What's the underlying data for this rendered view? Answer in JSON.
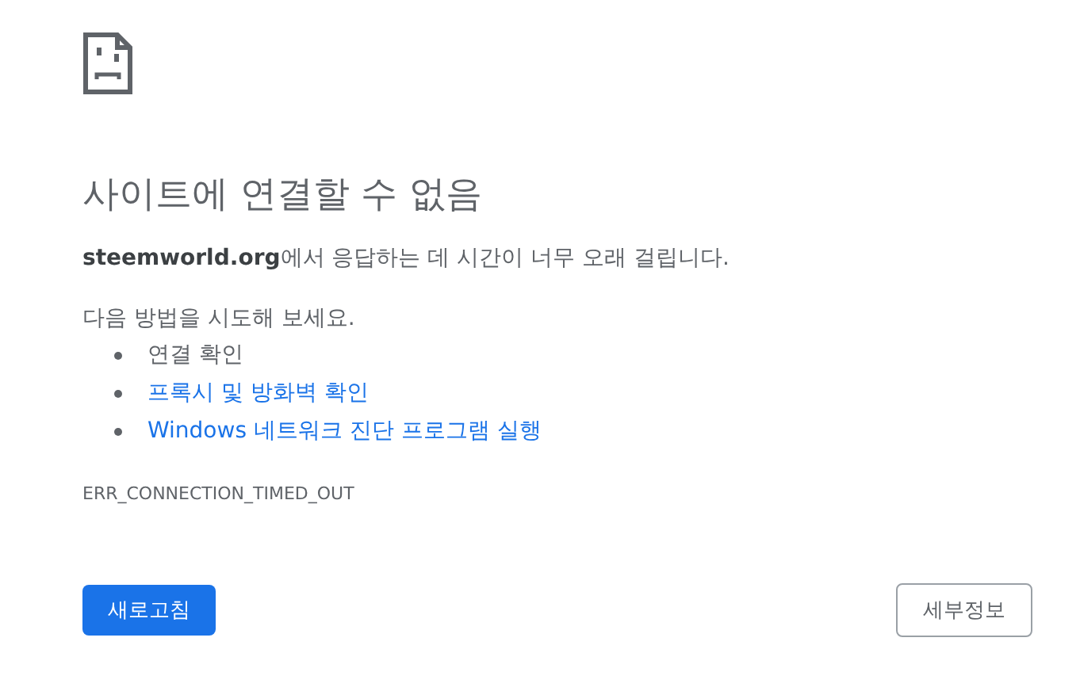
{
  "title": "사이트에 연결할 수 없음",
  "message": "**steemworld.org**에서 응답하는 데 시간이 너무 오래 걸립니다.",
  "suggestions": {
    "heading": "다음 방법을 시도해 보세요.",
    "items": [
      {
        "kind": "text",
        "label": "연결 확인"
      },
      {
        "kind": "link",
        "label": "프록시 및 방화벽 확인"
      },
      {
        "kind": "link",
        "label": "Windows 네트워크 진단 프로그램 실행"
      }
    ]
  },
  "error_code": "ERR_CONNECTION_TIMED_OUT",
  "buttons": {
    "reload": "새로고침",
    "details": "세부정보"
  }
}
